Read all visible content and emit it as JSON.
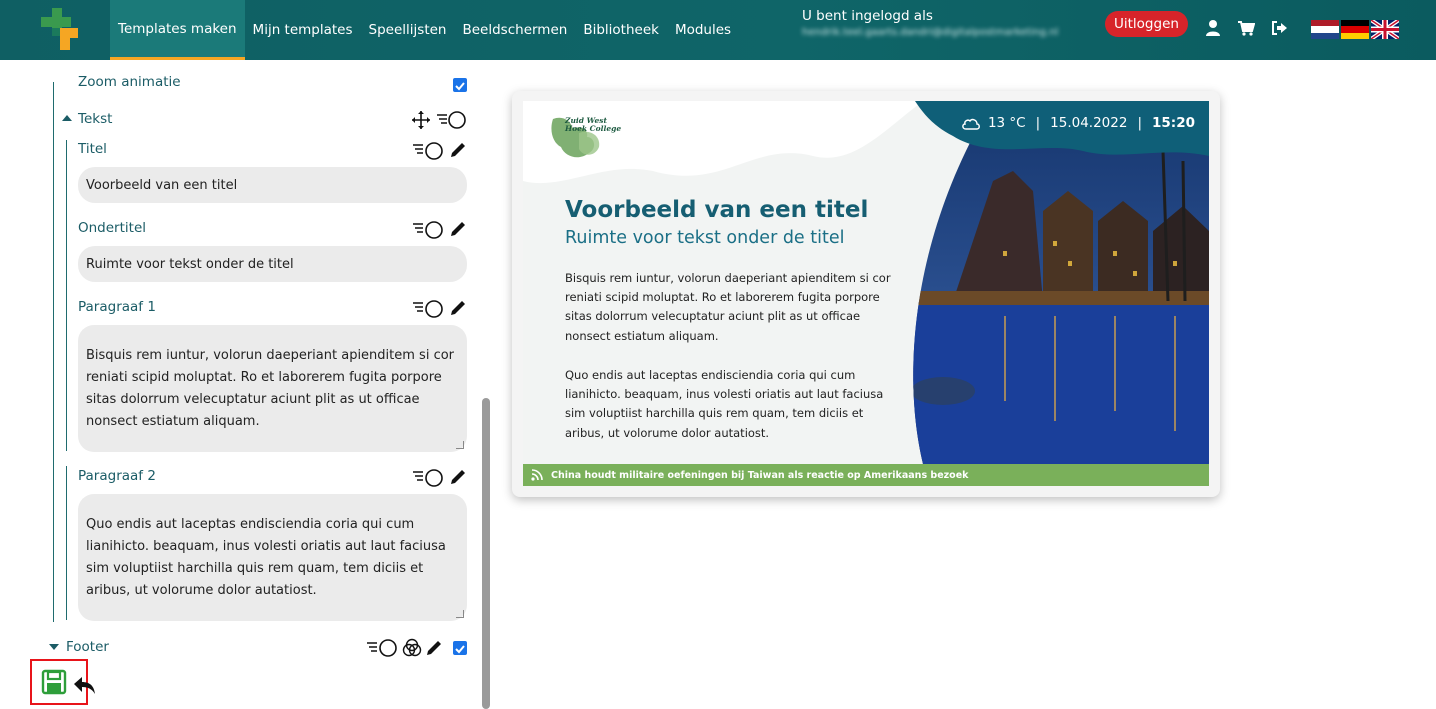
{
  "nav": {
    "items": [
      "Templates maken",
      "Mijn templates",
      "Speellijsten",
      "Beeldschermen",
      "Bibliotheek",
      "Modules"
    ],
    "active_index": 0
  },
  "user": {
    "logged_in_label": "U bent ingelogd als",
    "email": "hendrik.teel.gaarts.dandri@digitalpostmarketing.nl",
    "logout_label": "Uitloggen"
  },
  "icons": {
    "user": "user-icon",
    "cart": "cart-icon",
    "signout": "sign-out-icon"
  },
  "languages": [
    "nl",
    "de",
    "en"
  ],
  "editor": {
    "zoom_label": "Zoom animatie",
    "section_text": "Tekst",
    "title_label": "Titel",
    "title_value": "Voorbeeld van een titel",
    "subtitle_label": "Ondertitel",
    "subtitle_value": "Ruimte voor tekst onder de titel",
    "para1_label": "Paragraaf 1",
    "para1_value": "Bisquis rem iuntur, volorun daeperiant apienditem si cor reniati scipid moluptat.  Ro et laborerem fugita porpore sitas dolorrum velecuptatur aciunt plit as ut officae nonsect estiatum aliquam.",
    "para2_label": "Paragraaf 2",
    "para2_value": "Quo endis aut laceptas endisciendia coria qui cum lianihicto. beaquam, inus volesti oriatis aut laut faciusa sim voluptiist harchilla quis rem quam, tem diciis et aribus, ut volorume dolor autatiost.",
    "footer_label": "Footer"
  },
  "preview": {
    "logo_text": "Zuid West Hoek College",
    "temperature": "13 °C",
    "date": "15.04.2022",
    "time": "15:20",
    "title": "Voorbeeld van een titel",
    "subtitle": "Ruimte voor tekst onder de titel",
    "para1": "Bisquis rem iuntur, volorun daeperiant apienditem si cor reniati scipid moluptat. Ro et laborerem fugita porpore sitas dolorrum velecuptatur aciunt plit as ut officae nonsect estiatum aliquam.",
    "para2": "Quo endis aut laceptas endisciendia coria qui cum lianihicto. beaquam, inus volesti oriatis aut laut faciusa sim voluptiist harchilla quis rem quam, tem diciis et aribus, ut volorume dolor autatiost.",
    "ticker": "China houdt militaire oefeningen bij Taiwan als reactie op Amerikaans bezoek"
  },
  "colors": {
    "topbar": "#0f6568",
    "accent": "#f5a623",
    "logout": "#d7242a",
    "ticker": "#7ab05a",
    "save_highlight": "#e8141a",
    "save_icon": "#2e9e3a"
  }
}
